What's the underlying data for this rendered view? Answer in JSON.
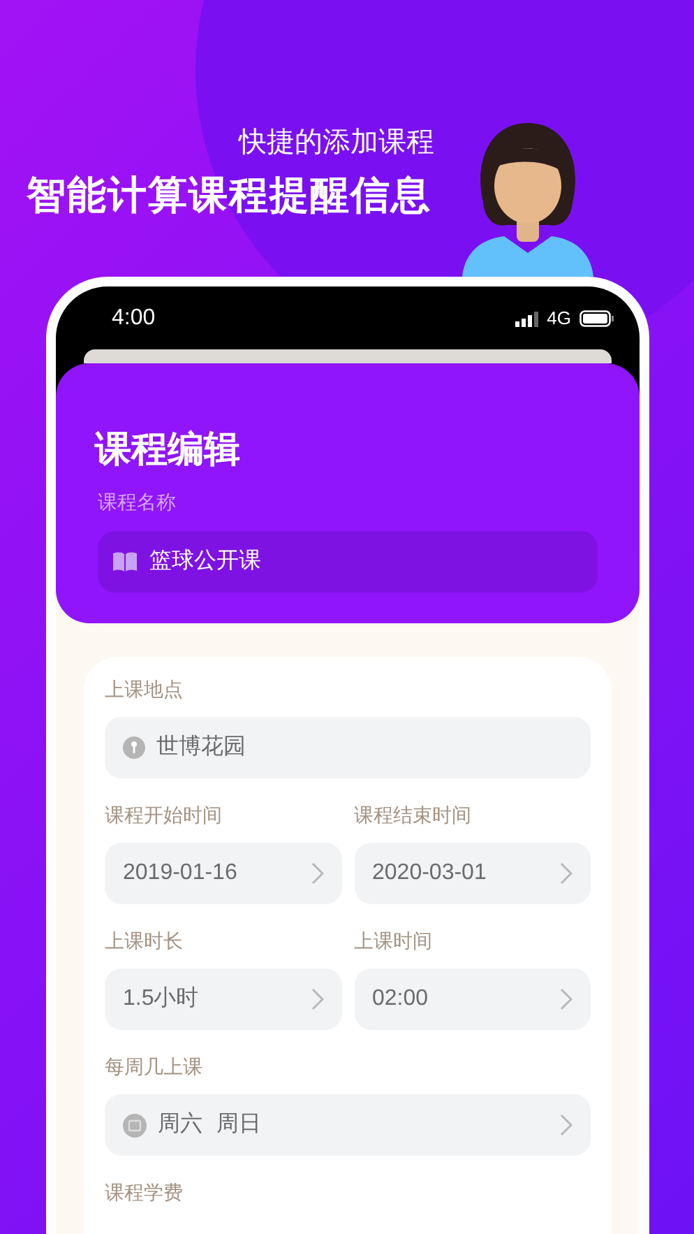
{
  "banner": {
    "subtitle": "快捷的添加课程",
    "title": "智能计算课程提醒信息"
  },
  "status_bar": {
    "time": "4:00",
    "network": "4G"
  },
  "editor": {
    "title": "课程编辑",
    "name_label": "课程名称",
    "name_value": "篮球公开课"
  },
  "form": [
    {
      "kind": "single",
      "label": "上课地点",
      "value": "世博花园"
    },
    {
      "kind": "pair",
      "items": [
        {
          "label": "课程开始时间",
          "value": "2019-01-16"
        },
        {
          "label": "课程结束时间",
          "value": "2020-03-01"
        }
      ]
    },
    {
      "kind": "pair",
      "items": [
        {
          "label": "上课时长",
          "value": "1.5小时"
        },
        {
          "label": "上课时间",
          "value": "02:00"
        }
      ]
    },
    {
      "kind": "days",
      "label": "每周几上课",
      "days": [
        "周六",
        "周日"
      ]
    },
    {
      "kind": "heading",
      "label": "课程学费"
    }
  ]
}
